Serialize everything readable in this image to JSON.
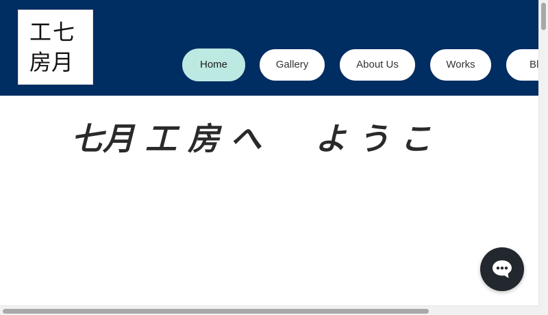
{
  "logo": {
    "line1": "工七",
    "line2": "房月"
  },
  "nav": {
    "items": [
      {
        "label": "Home",
        "active": true
      },
      {
        "label": "Gallery",
        "active": false
      },
      {
        "label": "About Us",
        "active": false
      },
      {
        "label": "Works",
        "active": false
      },
      {
        "label": "Blog",
        "active": false
      }
    ]
  },
  "main": {
    "headline": "七月 工 房 へ 　 よ う こ"
  },
  "chat": {
    "icon": "chat-bubble-icon"
  },
  "colors": {
    "header_bg": "#002d62",
    "active_nav_bg": "#bde9e3",
    "chat_bg": "#23272e"
  }
}
